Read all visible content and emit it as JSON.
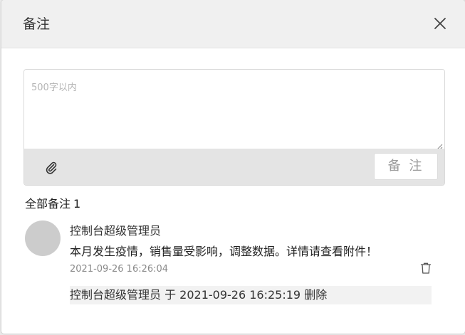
{
  "dialog": {
    "title": "备注",
    "close_icon": "close-icon"
  },
  "composer": {
    "placeholder": "500字以内",
    "value": "",
    "attach_icon": "paperclip-icon",
    "submit_label": "备 注"
  },
  "notes_header": {
    "label": "全部备注",
    "count": "1"
  },
  "notes": [
    {
      "author": "控制台超级管理员",
      "content": "本月发生疫情，销售量受影响，调整数据。详情请查看附件！",
      "timestamp": "2021-09-26 16:26:04",
      "delete_icon": "trash-icon",
      "deleted_log": "控制台超级管理员 于 2021-09-26 16:25:19 删除"
    }
  ],
  "colors": {
    "header_bg": "#f0f0f0",
    "toolbar_bg": "#e4e4e4",
    "avatar_bg": "#cccccc",
    "log_bg": "#f2f2f2"
  }
}
